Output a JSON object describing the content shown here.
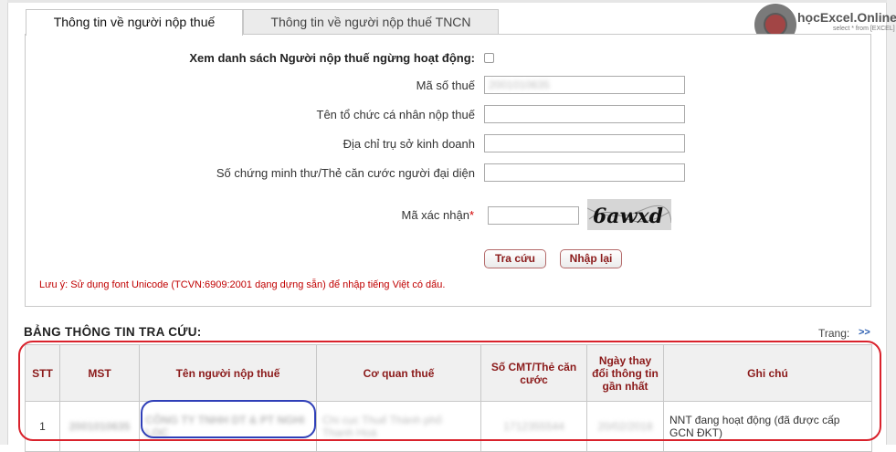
{
  "tabs": [
    {
      "label": "Thông tin về người nộp thuế",
      "active": true
    },
    {
      "label": "Thông tin về người nộp thuế TNCN",
      "active": false
    }
  ],
  "form": {
    "inactive_label": "Xem danh sách Người nộp thuế ngừng hoạt động:",
    "tax_code_label": "Mã số thuế",
    "tax_code_value": "2001010635",
    "org_name_label": "Tên tổ chức cá nhân nộp thuế",
    "address_label": "Địa chỉ trụ sở kinh doanh",
    "id_card_label": "Số chứng minh thư/Thẻ căn cước người đại diện",
    "captcha_label": "Mã xác nhận",
    "required_mark": "*",
    "captcha_text": "6awxd",
    "search_button": "Tra cứu",
    "reset_button": "Nhập lại",
    "note": "Lưu ý: Sử dụng font Unicode (TCVN:6909:2001 dạng dựng sẵn) để nhập tiếng Việt có dấu."
  },
  "results": {
    "title": "BẢNG THÔNG TIN TRA CỨU:",
    "page_label": "Trang:",
    "next_label": ">>",
    "columns": [
      "STT",
      "MST",
      "Tên người nộp thuế",
      "Cơ quan thuế",
      "Số CMT/Thẻ căn cước",
      "Ngày thay đổi thông tin gần nhất",
      "Ghi chú"
    ],
    "rows": [
      {
        "stt": "1",
        "mst": "2001010635",
        "name": "CÔNG TY TNHH DT & PT NGHI LOC",
        "agency": "Chi cục Thuế Thành phố Thanh Hoá",
        "id_card": "1712355544",
        "changed": "20/02/2018",
        "note": "NNT đang hoạt động (đã được cấp GCN ĐKT)"
      }
    ]
  },
  "watermark": {
    "brand": "họcExcel.Online",
    "tagline": "select * from [EXCEL]"
  },
  "colors": {
    "header_text": "#8b1a1a",
    "highlight_red": "#d9222c",
    "highlight_blue": "#2f3fb8",
    "note_red": "#c00000"
  }
}
